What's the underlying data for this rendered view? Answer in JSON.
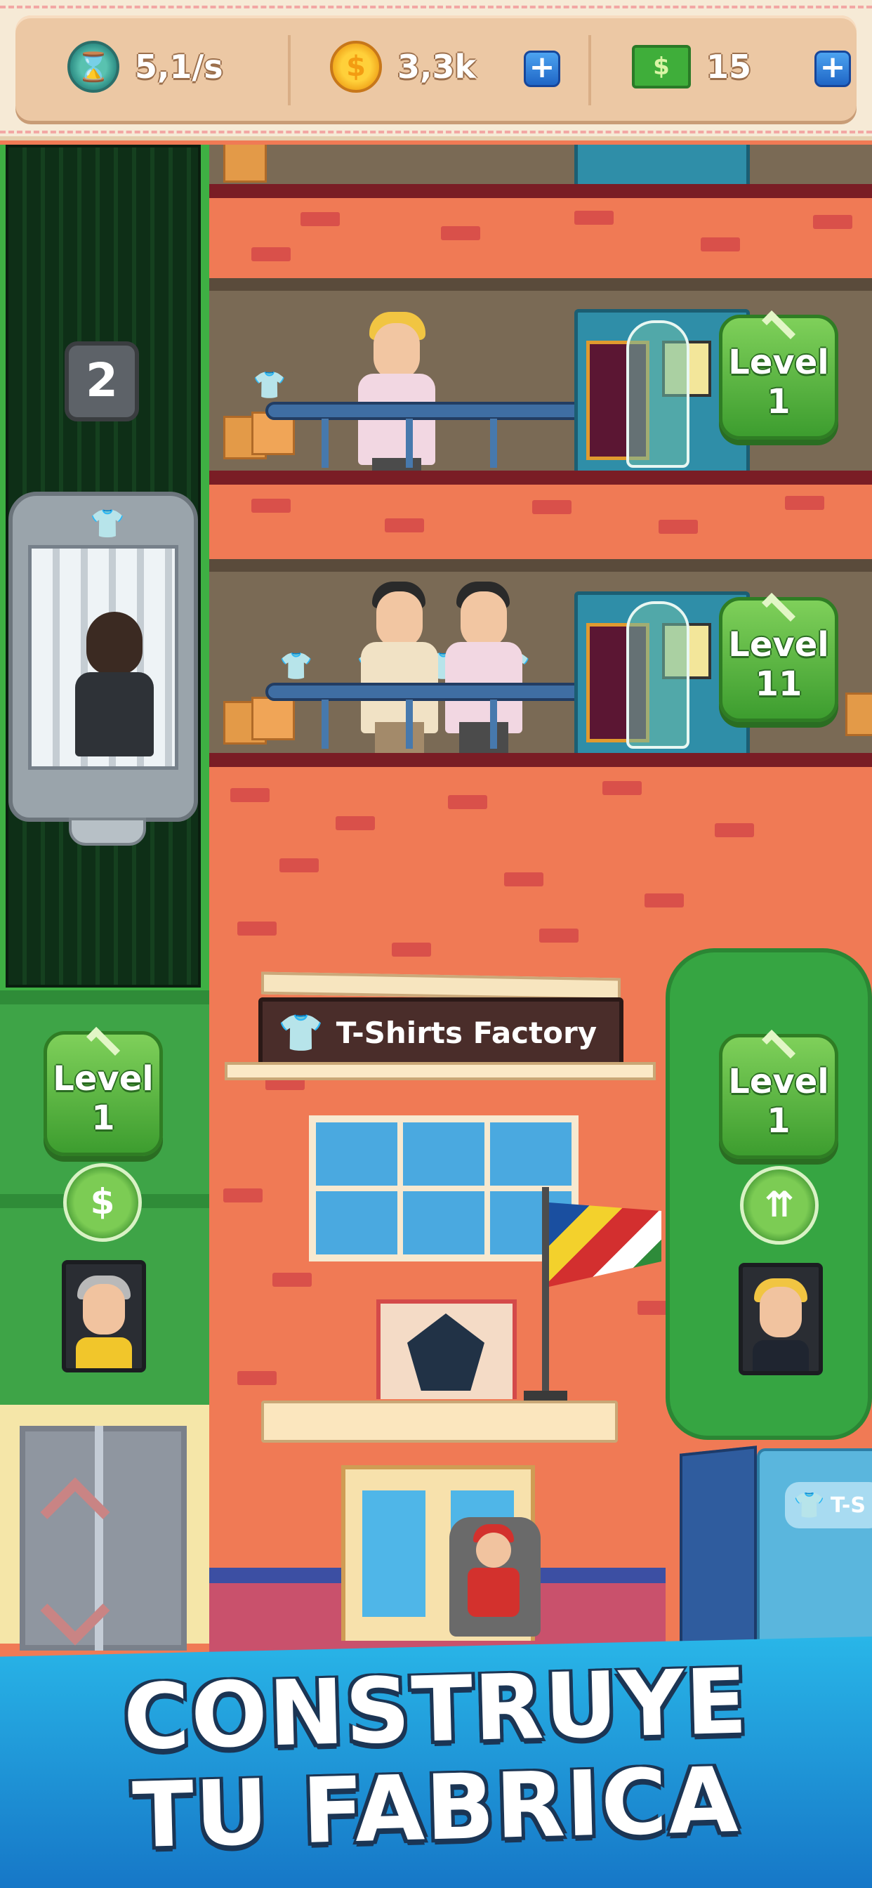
{
  "resources": {
    "rate": {
      "icon": "hourglass-icon",
      "value": "5,1/s"
    },
    "coins": {
      "icon": "coin-icon",
      "value": "3,3k",
      "add_label": "+"
    },
    "cash": {
      "icon": "cash-icon",
      "value": "15",
      "add_label": "+"
    }
  },
  "elevator": {
    "floor_counter": "2",
    "level_label": "Level",
    "level_value": "1",
    "upgrade_icon": "$"
  },
  "floors": [
    {
      "level_label": "Level",
      "level_value": "1"
    },
    {
      "level_label": "Level",
      "level_value": "11"
    }
  ],
  "factory": {
    "sign_text": "T-Shirts Factory",
    "truck_label": "T-S"
  },
  "warehouse": {
    "level_label": "Level",
    "level_value": "1",
    "upgrade_icon": "⇈"
  },
  "banner": {
    "line1": "CONSTRUYE",
    "line2": "TU FABRICA"
  },
  "colors": {
    "brick_wall": "#f07a55",
    "level_badge": "#4fae38",
    "banner": "#1e95d6"
  }
}
